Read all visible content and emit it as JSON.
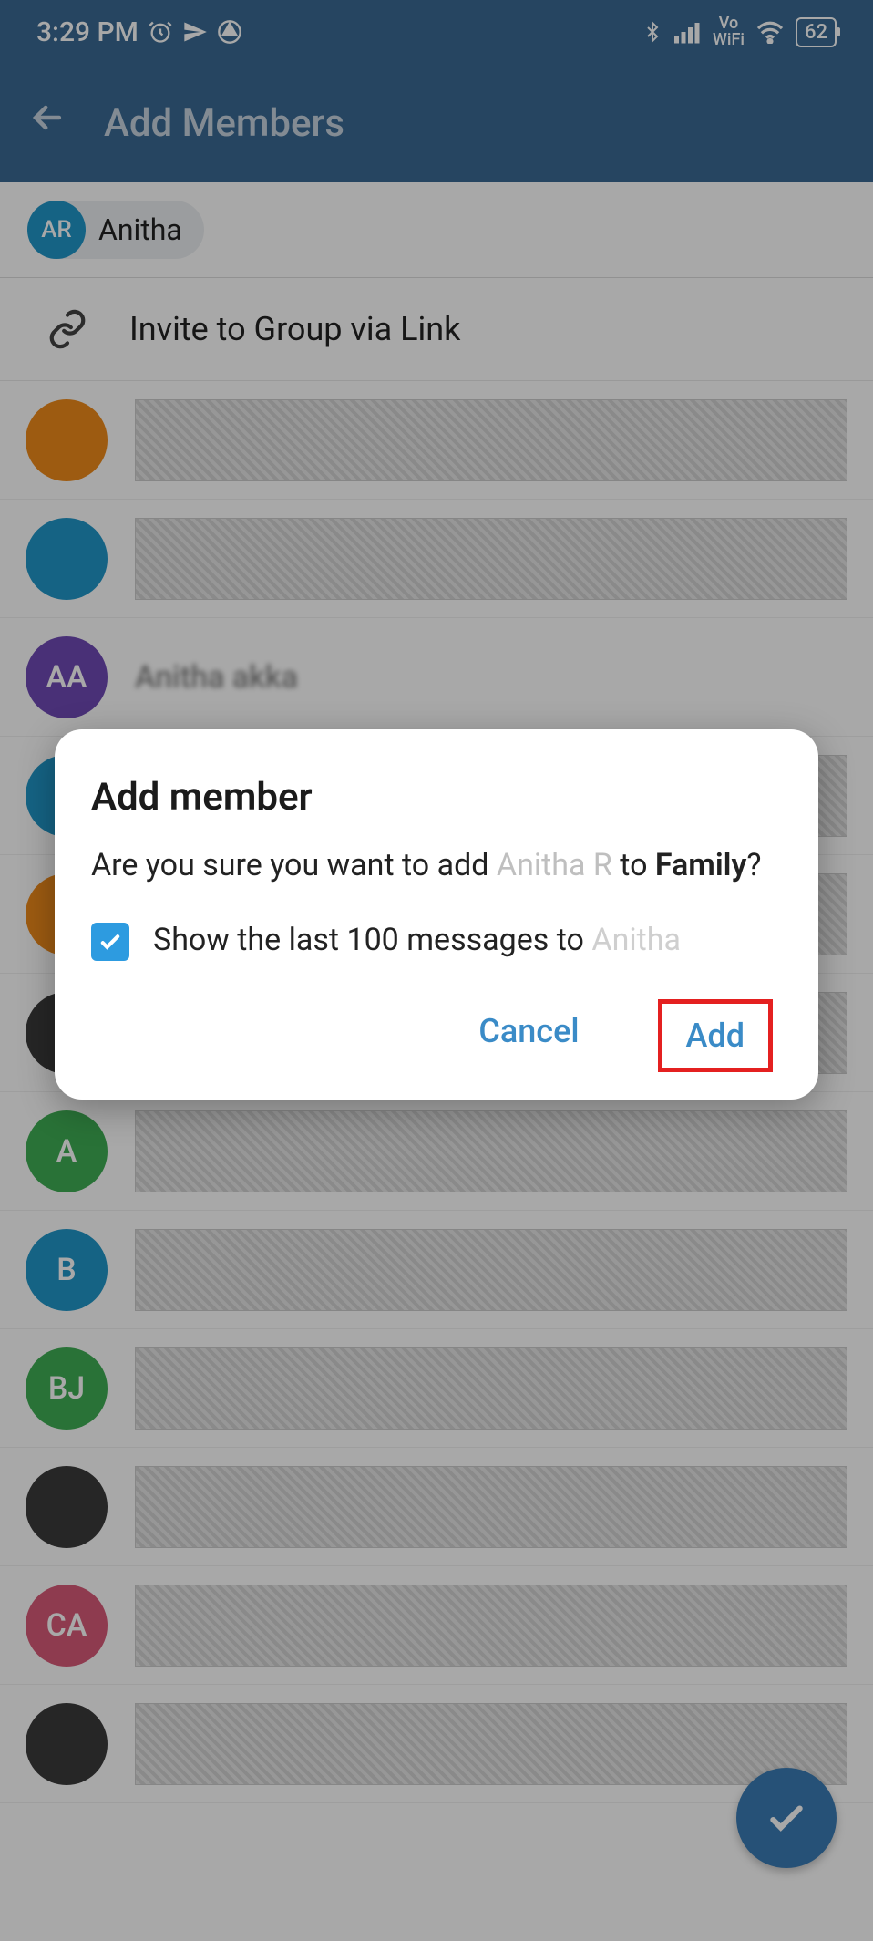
{
  "status": {
    "time": "3:29 PM",
    "vowifi_top": "Vo",
    "vowifi_bottom": "WiFi",
    "battery": "62"
  },
  "header": {
    "title": "Add Members"
  },
  "chip": {
    "initials": "AR",
    "name": "Anitha"
  },
  "invite": {
    "label": "Invite to Group via Link"
  },
  "contacts": [
    {
      "initials": "",
      "color": "av-orange",
      "name": ""
    },
    {
      "initials": "",
      "color": "av-blue",
      "name": ""
    },
    {
      "initials": "AA",
      "color": "av-purple",
      "name": "Anitha akka"
    },
    {
      "initials": "",
      "color": "av-blue",
      "name": ""
    },
    {
      "initials": "",
      "color": "av-orange",
      "name": ""
    },
    {
      "initials": "",
      "color": "av-dark",
      "name": ""
    },
    {
      "initials": "A",
      "color": "av-green",
      "name": ""
    },
    {
      "initials": "B",
      "color": "av-blue",
      "name": ""
    },
    {
      "initials": "BJ",
      "color": "av-green",
      "name": ""
    },
    {
      "initials": "",
      "color": "av-dark",
      "name": ""
    },
    {
      "initials": "CA",
      "color": "av-pink",
      "name": ""
    },
    {
      "initials": "",
      "color": "av-dark",
      "name": ""
    }
  ],
  "dialog": {
    "title": "Add member",
    "q1": "Are you sure you want to add ",
    "member": "Anitha R",
    "q2": " to ",
    "group": "Family",
    "qend": "?",
    "check_pre": "Show the last 100 messages to ",
    "check_name": "Anitha",
    "cancel": "Cancel",
    "add": "Add"
  }
}
